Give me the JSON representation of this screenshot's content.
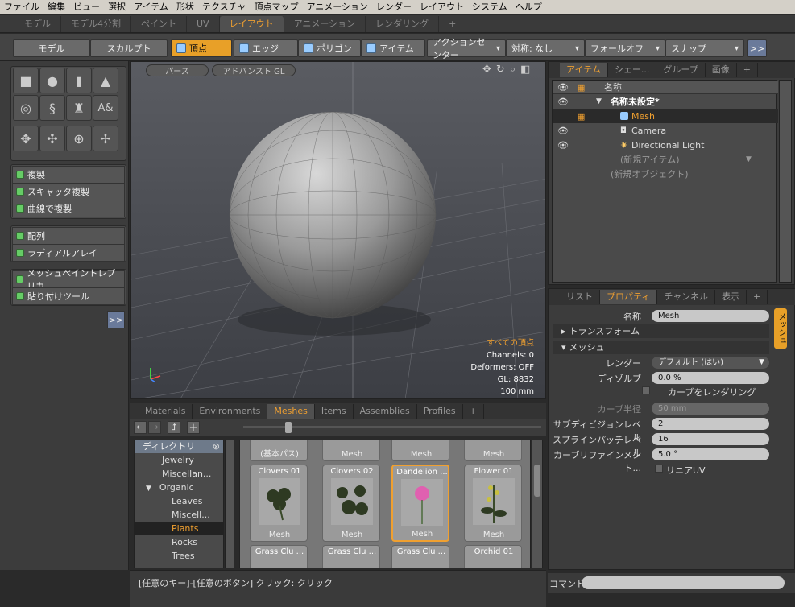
{
  "menu": [
    "ファイル",
    "編集",
    "ビュー",
    "選択",
    "アイテム",
    "形状",
    "テクスチャ",
    "頂点マップ",
    "アニメーション",
    "レンダー",
    "レイアウト",
    "システム",
    "ヘルプ"
  ],
  "layout_tabs": [
    "モデル",
    "モデル4分割",
    "ペイント",
    "UV",
    "レイアウト",
    "アニメーション",
    "レンダリング",
    "+"
  ],
  "toolbar": {
    "model": "モデル",
    "sculpt": "スカルプト",
    "vertex": "頂点",
    "edge": "エッジ",
    "polygon": "ポリゴン",
    "item": "アイテム",
    "action_center": "アクションセンター",
    "symmetry": "対称: なし",
    "falloff": "フォールオフ",
    "snap": "スナップ",
    "more": ">>"
  },
  "left_tools": {
    "duplicate": "複製",
    "scatter": "スキャッタ複製",
    "curve_dup": "曲線で複製",
    "array": "配列",
    "radial": "ラディアルアレイ",
    "mesh_paint": "メッシュペイントレプリカ",
    "paste_tool": "貼り付けツール",
    "more": ">>",
    "text_icon": "A&"
  },
  "viewport": {
    "persp": "パース",
    "gl": "アドバンスト GL",
    "all_vertices": "すべての頂点",
    "channels": "Channels: 0",
    "deformers": "Deformers: OFF",
    "gl_count": "GL: 8832",
    "scale": "100 mm"
  },
  "preset_tabs": [
    "Materials",
    "Environments",
    "Meshes",
    "Items",
    "Assemblies",
    "Profiles",
    "+"
  ],
  "directory": {
    "header": "ディレクトリ",
    "items": [
      "Jewelry",
      "Miscellan...",
      "Organic",
      "Leaves",
      "Miscell...",
      "Plants",
      "Rocks",
      "Trees"
    ]
  },
  "presets": {
    "top_row": [
      "(基本パス)",
      "Mesh",
      "Mesh",
      "Mesh"
    ],
    "row1": [
      {
        "title": "Clovers 01",
        "type": "Mesh"
      },
      {
        "title": "Clovers 02",
        "type": "Mesh"
      },
      {
        "title": "Dandelion ...",
        "type": "Mesh"
      },
      {
        "title": "Flower 01",
        "type": "Mesh"
      }
    ],
    "row2": [
      "Grass Clu ...",
      "Grass Clu ...",
      "Grass Clu ...",
      "Orchid 01"
    ]
  },
  "status": "[任意のキー]-[任意のボタン] クリック:  クリック",
  "scene": {
    "tabs": [
      "アイテム",
      "シェー...",
      "グループ",
      "画像",
      "+"
    ],
    "col_name": "名称",
    "items": [
      "名称未設定*",
      "Mesh",
      "Camera",
      "Directional Light",
      "(新規アイテム)",
      "(新規オブジェクト)"
    ]
  },
  "props": {
    "tabs": [
      "リスト",
      "プロパティ",
      "チャンネル",
      "表示",
      "+"
    ],
    "side_tab": "メッシュ",
    "name_label": "名称",
    "name_value": "Mesh",
    "transform": "トランスフォーム",
    "mesh": "メッシュ",
    "render_label": "レンダー",
    "render_value": "デフォルト (はい)",
    "dissolve_label": "ディゾルブ",
    "dissolve_value": "0.0 %",
    "render_curves": "カーブをレンダリング",
    "curve_radius_label": "カーブ半径",
    "curve_radius_value": "50 mm",
    "subdiv_label": "サブディビジョンレベル",
    "subdiv_value": "2",
    "spline_label": "スプラインパッチレベル",
    "spline_value": "16",
    "curve_refine_label": "カーブリファインメント...",
    "curve_refine_value": "5.0 °",
    "linear_uv": "リニアUV"
  },
  "command_label": "コマンド"
}
